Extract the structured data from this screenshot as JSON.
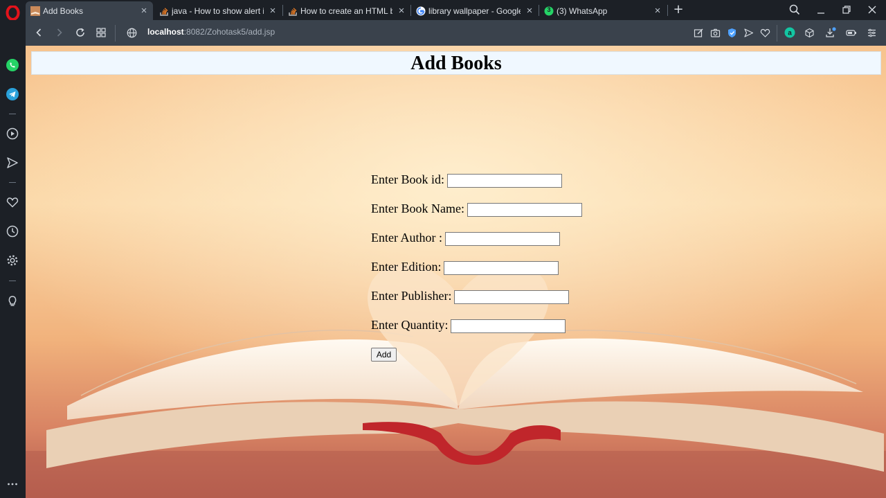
{
  "browser": {
    "tabs": [
      {
        "label": "Add Books",
        "active": true
      },
      {
        "label": "java - How to show alert in",
        "active": false
      },
      {
        "label": "How to create an HTML bu",
        "active": false
      },
      {
        "label": "library wallpaper - Google",
        "active": false
      },
      {
        "label": "(3) WhatsApp",
        "active": false
      }
    ],
    "whatsapp_badge": "3",
    "url_host": "localhost",
    "url_rest": ":8082/Zohotask5/add.jsp"
  },
  "page": {
    "title": "Add Books",
    "fields": [
      {
        "label": "Enter Book id:",
        "value": ""
      },
      {
        "label": "Enter Book Name:",
        "value": ""
      },
      {
        "label": "Enter Author :",
        "value": ""
      },
      {
        "label": "Enter Edition:",
        "value": ""
      },
      {
        "label": "Enter Publisher:",
        "value": ""
      },
      {
        "label": "Enter Quantity:",
        "value": ""
      }
    ],
    "submit_label": "Add"
  },
  "icons": {
    "sidebar": [
      "opera-logo-icon",
      "whatsapp-icon",
      "telegram-icon",
      "player-icon",
      "send-icon",
      "heart-icon",
      "history-icon",
      "settings-icon",
      "lightbulb-icon",
      "more-icon"
    ],
    "toolbar": [
      "back-icon",
      "forward-icon",
      "reload-icon",
      "speed-dial-icon",
      "site-info-icon",
      "edit-icon",
      "camera-icon",
      "shield-icon",
      "send-icon",
      "heart-icon",
      "aria-icon",
      "box-icon",
      "download-icon",
      "battery-icon",
      "easy-setup-icon"
    ]
  },
  "colors": {
    "chrome_dark": "#1c2026",
    "chrome_toolbar": "#3a424c",
    "heading_bg": "#f0f8ff",
    "opera_red": "#e3131b",
    "whatsapp_green": "#25d366",
    "telegram_blue": "#2aa1da"
  }
}
